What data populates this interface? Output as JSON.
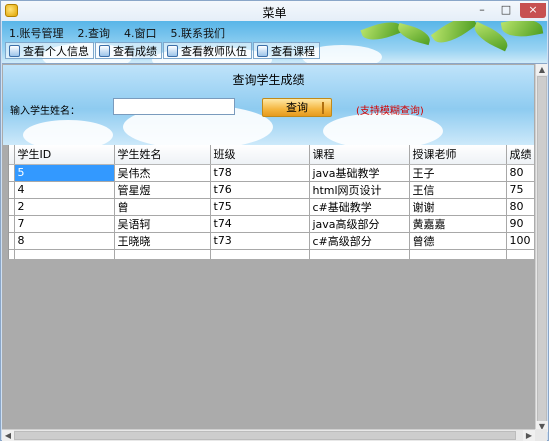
{
  "window": {
    "title": "菜单",
    "close_glyph": "×",
    "min_glyph": "–",
    "max_glyph": "□"
  },
  "menu": [
    "1.账号管理",
    "2.查询",
    "4.窗口",
    "5.联系我们"
  ],
  "toolbar": [
    "查看个人信息",
    "查看成绩",
    "查看教师队伍",
    "查看课程"
  ],
  "panel": {
    "title": "查询学生成绩",
    "name_label": "输入学生姓名：",
    "name_value": "",
    "query_button": "查询",
    "hint": "(支持模糊查询)"
  },
  "grid": {
    "columns": [
      "学生ID",
      "学生姓名",
      "班级",
      "课程",
      "授课老师",
      "成绩"
    ],
    "rows": [
      [
        "5",
        "吴伟杰",
        "t78",
        "java基础教学",
        "王子",
        "80"
      ],
      [
        "4",
        "管星煜",
        "t76",
        "html网页设计",
        "王信",
        "75"
      ],
      [
        "2",
        "曾",
        "t75",
        "c#基础教学",
        "谢谢",
        "80"
      ],
      [
        "7",
        "吴语轲",
        "t74",
        "java高级部分",
        "黄嘉嘉",
        "90"
      ],
      [
        "8",
        "王晓晓",
        "t73",
        "c#高级部分",
        "曾德",
        "100"
      ]
    ]
  },
  "colors": {
    "selection": "#3399ff",
    "hint": "#d30000",
    "banner": "#58b5e8"
  },
  "icons": {
    "app": "app-icon",
    "toolbar": "document-icon"
  }
}
